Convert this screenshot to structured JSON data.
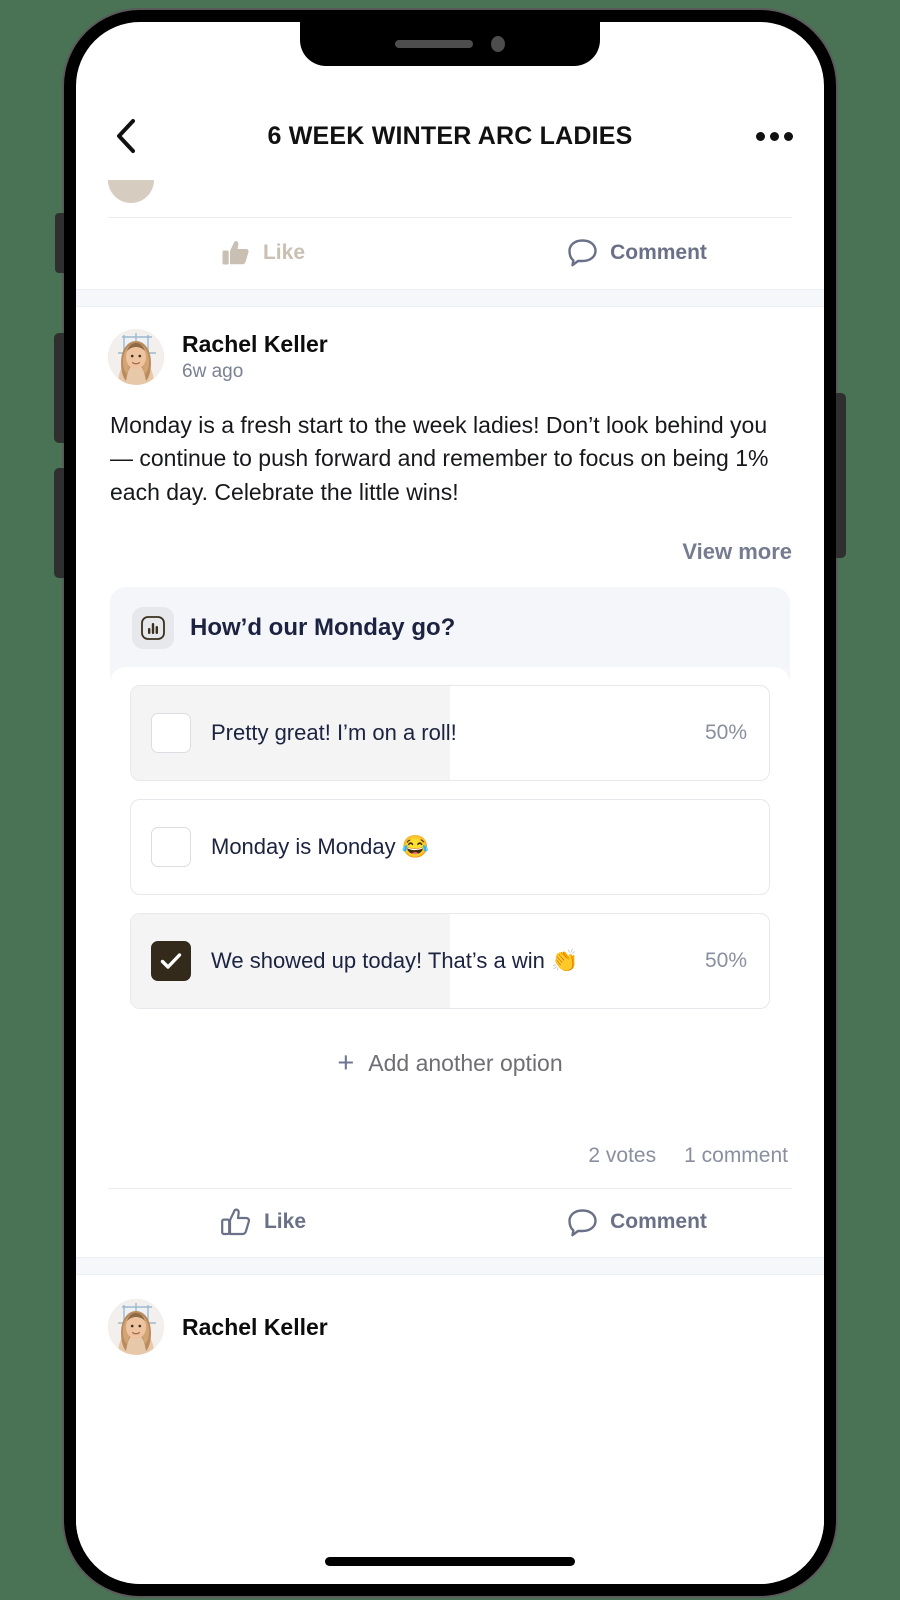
{
  "device": {
    "frame": "iphone",
    "background_color": "#4a7254",
    "notch": {
      "speaker": "speaker-slot",
      "camera": "front-camera"
    },
    "side_buttons": [
      "silent-switch",
      "volume-up",
      "volume-down",
      "power"
    ],
    "home_indicator": true
  },
  "header": {
    "back_icon": "chevron-left-icon",
    "title": "6 WEEK WINTER ARC LADIES",
    "more_icon": "more-horizontal-icon"
  },
  "previous_post_actions": {
    "like_label": "Like",
    "like_icon": "thumbs-up-filled-icon",
    "like_color": "#c9bfb3",
    "comment_label": "Comment",
    "comment_icon": "comment-bubble-icon",
    "comment_color": "#6a7087"
  },
  "post": {
    "author": "Rachel Keller",
    "avatar_icon": "user-avatar-photo",
    "timestamp": "6w ago",
    "body": "Monday is a fresh start to the week ladies! Don’t look behind you — continue to push forward and remember to focus on being 1% each day. Celebrate the little wins!",
    "view_more_label": "View more",
    "poll": {
      "icon": "bar-chart-icon",
      "question": "How’d our Monday go?",
      "options": [
        {
          "label": "Pretty great! I’m on a roll!",
          "percent_label": "50%",
          "percent": 50,
          "checked": false
        },
        {
          "label": "Monday is Monday 😂",
          "percent_label": "",
          "percent": 0,
          "checked": false
        },
        {
          "label": "We showed up today! That’s a win 👏",
          "percent_label": "50%",
          "percent": 50,
          "checked": true
        }
      ],
      "add_option_plus": "+",
      "add_option_label": "Add another option"
    },
    "votes_label": "2 votes",
    "comments_label": "1 comment",
    "actions": {
      "like_label": "Like",
      "like_icon": "thumbs-up-outline-icon",
      "comment_label": "Comment",
      "comment_icon": "comment-bubble-icon",
      "color": "#6a7087"
    }
  },
  "next_post": {
    "author": "Rachel Keller",
    "avatar_icon": "user-avatar-photo"
  }
}
